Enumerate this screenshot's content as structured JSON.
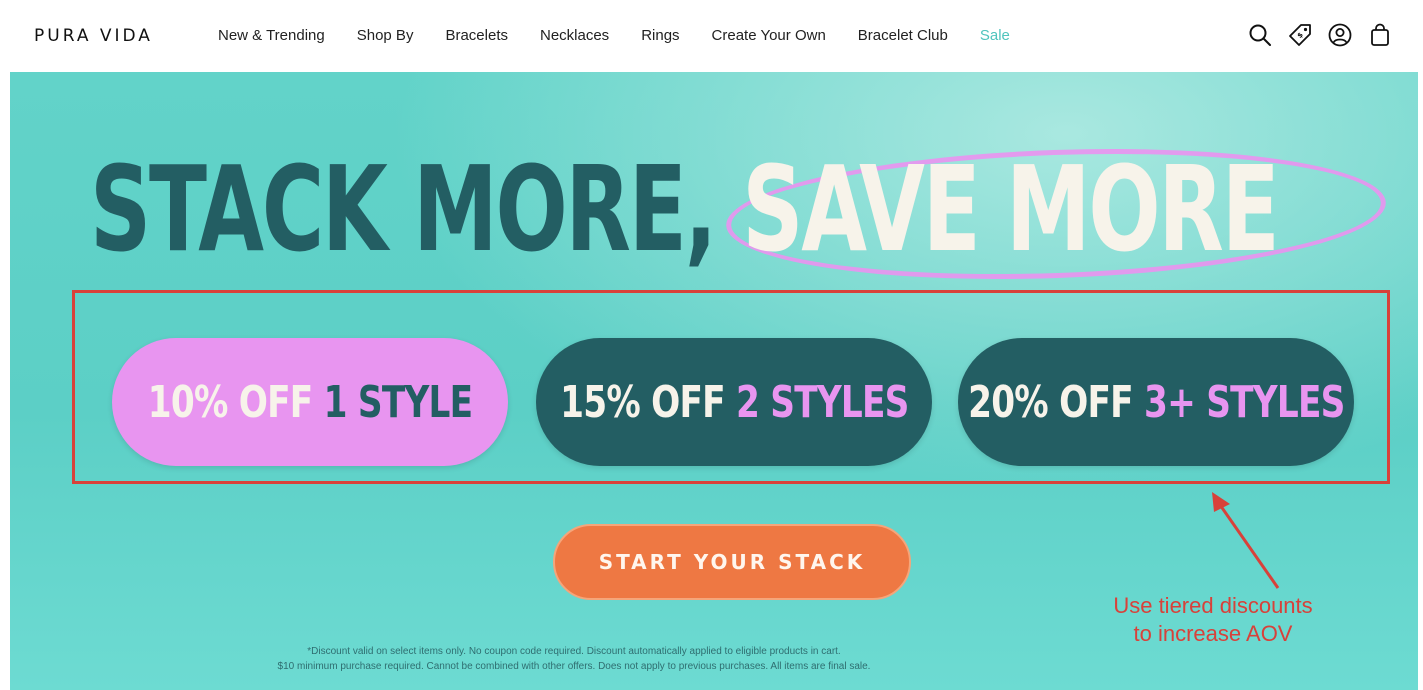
{
  "header": {
    "logo": "PURA VIDA",
    "nav": [
      {
        "label": "New & Trending"
      },
      {
        "label": "Shop By"
      },
      {
        "label": "Bracelets"
      },
      {
        "label": "Necklaces"
      },
      {
        "label": "Rings"
      },
      {
        "label": "Create Your Own"
      },
      {
        "label": "Bracelet Club"
      },
      {
        "label": "Sale"
      }
    ],
    "icons": [
      "search-icon",
      "rewards-tag-icon",
      "account-icon",
      "cart-icon"
    ]
  },
  "hero": {
    "headline_dark": "STACK MORE,",
    "headline_light": "SAVE MORE",
    "tiers": [
      {
        "part1": "10% OFF",
        "part2": "1 STYLE"
      },
      {
        "part1": "15% OFF",
        "part2": "2 STYLES"
      },
      {
        "part1": "20% OFF",
        "part2": "3+ STYLES"
      }
    ],
    "cta_label": "START YOUR STACK",
    "disclaimer_line1": "*Discount valid on select items only. No coupon code required. Discount automatically applied to eligible products in cart.",
    "disclaimer_line2": "$10 minimum purchase required. Cannot be combined with other offers. Does not apply to previous purchases. All items are final sale."
  },
  "annotation": {
    "line1": "Use tiered discounts",
    "line2": "to increase AOV"
  },
  "colors": {
    "teal_bg": "#5ccfc6",
    "dark_teal": "#235e63",
    "pink": "#e895f0",
    "orange": "#ee7843",
    "annotation_red": "#d8413a",
    "sale_link": "#4fc4bd"
  }
}
